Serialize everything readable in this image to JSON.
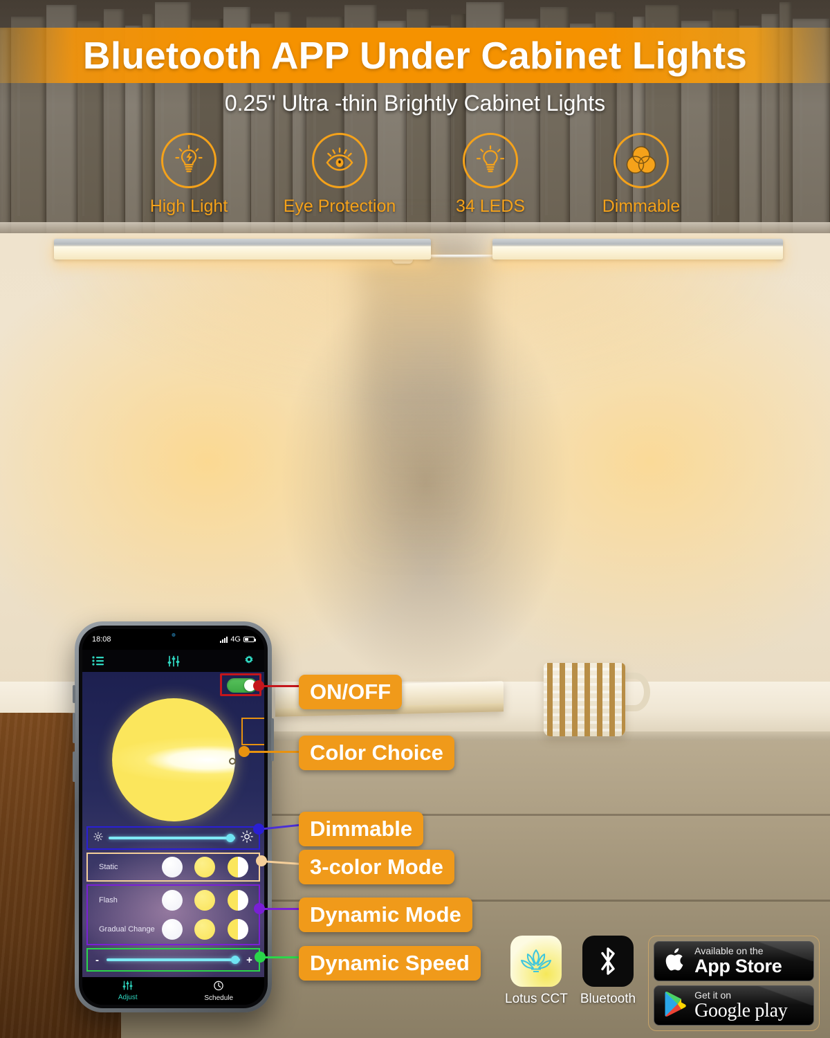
{
  "header": {
    "title": "Bluetooth APP Under Cabinet Lights",
    "subtitle": "0.25\" Ultra -thin Brightly Cabinet Lights",
    "band_color": "#f59200",
    "accent_color": "#f5a21a"
  },
  "features": [
    {
      "label": "High Light",
      "icon": "bulb-bolt-icon"
    },
    {
      "label": "Eye Protection",
      "icon": "eye-icon"
    },
    {
      "label": "34 LEDS",
      "icon": "bulb-rays-icon"
    },
    {
      "label": "Dimmable",
      "icon": "venn-circles-icon"
    }
  ],
  "phone": {
    "status_bar": {
      "time": "18:08",
      "network": "4G"
    },
    "app_header": {
      "list_icon": "list-icon",
      "sliders_icon": "sliders-icon",
      "gear_icon": "gear-icon"
    },
    "power_toggle": {
      "state": "on"
    },
    "color_wheel": {
      "selected_label": ""
    },
    "brightness": {
      "min_icon": "sun-small-icon",
      "max_icon": "sun-large-icon",
      "value": 97
    },
    "modes": [
      {
        "label": "Static",
        "swatches": [
          "white",
          "yellow",
          "half"
        ]
      },
      {
        "label": "Flash",
        "swatches": [
          "white",
          "yellow",
          "half"
        ]
      },
      {
        "label": "Gradual Change",
        "swatches": [
          "white",
          "yellow",
          "half"
        ]
      }
    ],
    "speed": {
      "minus": "-",
      "plus": "+",
      "value": 95
    },
    "tabs": [
      {
        "label": "Adjust",
        "icon": "sliders-icon",
        "active": true
      },
      {
        "label": "Schedule",
        "icon": "clock-icon",
        "active": false
      }
    ]
  },
  "callouts": [
    {
      "label": "ON/OFF",
      "accent": "#c4161c"
    },
    {
      "label": "Color Choice",
      "accent": "#e8920f"
    },
    {
      "label": "Dimmable",
      "accent": "#2a1fd6"
    },
    {
      "label": "3-color Mode",
      "accent": "#f5cf9a"
    },
    {
      "label": "Dynamic Mode",
      "accent": "#7a1fd6"
    },
    {
      "label": "Dynamic Speed",
      "accent": "#2ad64a"
    }
  ],
  "badges": {
    "lotus": {
      "caption": "Lotus CCT",
      "icon": "lotus-icon"
    },
    "bluetooth": {
      "caption": "Bluetooth",
      "icon": "bluetooth-icon"
    },
    "appstore": {
      "small": "Available on the",
      "big": "App Store",
      "icon": "apple-icon"
    },
    "googleplay": {
      "small": "Get it on",
      "big": "Google play",
      "icon": "google-play-icon"
    }
  }
}
